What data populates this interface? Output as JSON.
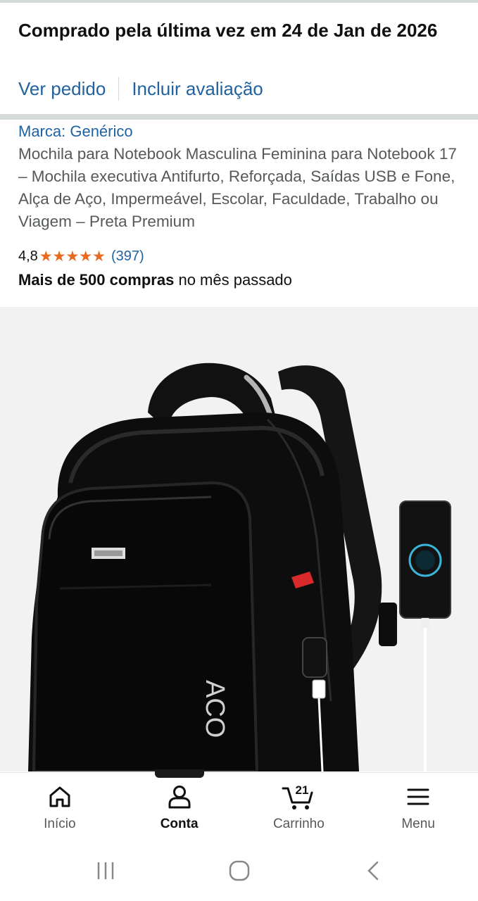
{
  "purchase": {
    "title": "Comprado pela última vez em 24 de Jan de 2026",
    "view_order": "Ver pedido",
    "add_review": "Incluir avaliação"
  },
  "product": {
    "brand": "Marca: Genérico",
    "title": "Mochila para Notebook Masculina Feminina para Notebook 17 – Mochila executiva Antifurto, Reforçada, Saídas USB e Fone, Alça de Aço, Impermeável, Escolar, Faculdade, Trabalho ou Viagem – Preta Premium",
    "rating": "4,8",
    "stars": 5,
    "review_count": "(397)",
    "sales_bold": "Mais de 500 compras",
    "sales_rest": "no mês passado",
    "image_text": "ACO",
    "star_color": "#e86a1f",
    "link_color": "#2162a1"
  },
  "bottom_nav": {
    "home": "Início",
    "account": "Conta",
    "cart": "Carrinho",
    "cart_count": "21",
    "menu": "Menu"
  },
  "icons": [
    "home-icon",
    "account-icon",
    "cart-icon",
    "menu-icon",
    "recent-apps-icon",
    "home-circle-icon",
    "back-icon"
  ]
}
